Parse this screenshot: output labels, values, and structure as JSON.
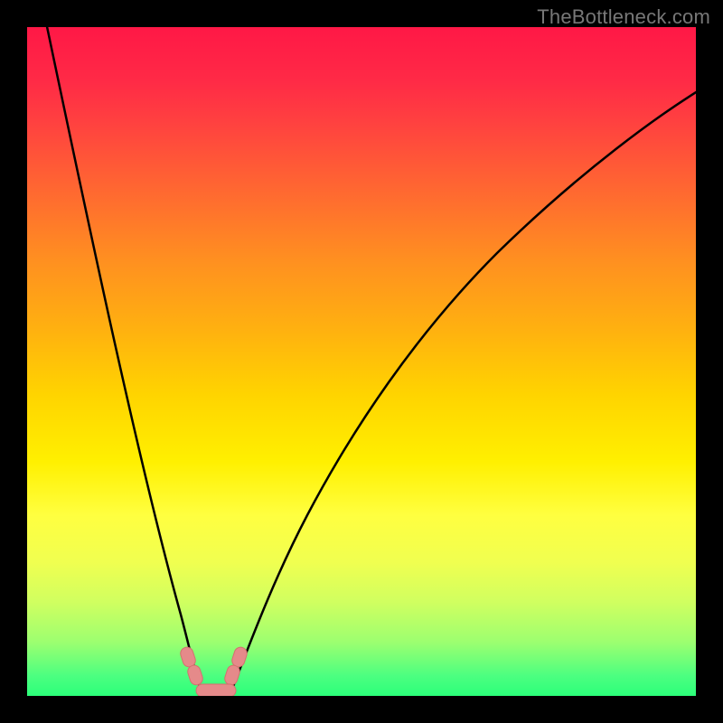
{
  "watermark": "TheBottleneck.com",
  "chart_data": {
    "type": "line",
    "title": "",
    "xlabel": "",
    "ylabel": "",
    "ylim": [
      0,
      100
    ],
    "xlim": [
      0,
      100
    ],
    "x": [
      0,
      5,
      10,
      15,
      20,
      23,
      25,
      27,
      30,
      35,
      40,
      45,
      50,
      60,
      70,
      80,
      90,
      100
    ],
    "values": [
      100,
      78,
      56,
      34,
      13,
      3,
      0,
      0,
      3,
      13,
      23,
      32,
      40,
      53,
      63,
      71,
      78,
      83
    ],
    "annotations": [
      {
        "label": "marker-left-upper",
        "x": 22,
        "y": 7
      },
      {
        "label": "marker-left-lower",
        "x": 23,
        "y": 4
      },
      {
        "label": "marker-right-upper",
        "x": 31,
        "y": 7
      },
      {
        "label": "marker-right-lower",
        "x": 30,
        "y": 4
      },
      {
        "label": "marker-bottom-left",
        "x": 25,
        "y": 0
      },
      {
        "label": "marker-bottom-right",
        "x": 29,
        "y": 0
      }
    ],
    "background_gradient": {
      "top": "#ff1846",
      "middle": "#fff000",
      "bottom": "#2cff7a"
    }
  }
}
